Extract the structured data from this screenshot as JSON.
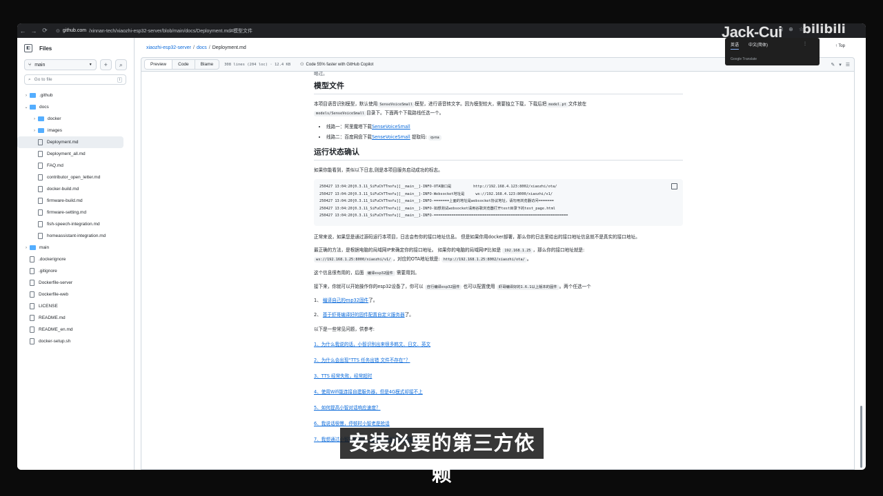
{
  "browser": {
    "url_host": "github.com",
    "url_path": "/xinnan-tech/xiaozhi-esp32-server/blob/main/docs/Deployment.md#模型文件"
  },
  "sidebar": {
    "title": "Files",
    "branch": "main",
    "goto_placeholder": "Go to file",
    "goto_kbd": "t",
    "items": [
      {
        "label": ".github",
        "type": "folder",
        "expanded": false,
        "depth": 0
      },
      {
        "label": "docs",
        "type": "folder",
        "expanded": true,
        "depth": 0
      },
      {
        "label": "docker",
        "type": "folder",
        "expanded": false,
        "depth": 1
      },
      {
        "label": "images",
        "type": "folder",
        "expanded": false,
        "depth": 1
      },
      {
        "label": "Deployment.md",
        "type": "file",
        "depth": 1,
        "selected": true
      },
      {
        "label": "Deployment_all.md",
        "type": "file",
        "depth": 1
      },
      {
        "label": "FAQ.md",
        "type": "file",
        "depth": 1
      },
      {
        "label": "contributor_open_letter.md",
        "type": "file",
        "depth": 1
      },
      {
        "label": "docker-build.md",
        "type": "file",
        "depth": 1
      },
      {
        "label": "firmware-build.md",
        "type": "file",
        "depth": 1
      },
      {
        "label": "firmware-setting.md",
        "type": "file",
        "depth": 1
      },
      {
        "label": "fish-speech-integration.md",
        "type": "file",
        "depth": 1
      },
      {
        "label": "homeassistant-integration.md",
        "type": "file",
        "depth": 1
      },
      {
        "label": "main",
        "type": "folder",
        "expanded": false,
        "depth": 0
      },
      {
        "label": ".dockerignore",
        "type": "file",
        "depth": 0
      },
      {
        "label": ".gitignore",
        "type": "file",
        "depth": 0
      },
      {
        "label": "Dockerfile-server",
        "type": "file",
        "depth": 0
      },
      {
        "label": "Dockerfile-web",
        "type": "file",
        "depth": 0
      },
      {
        "label": "LICENSE",
        "type": "file",
        "depth": 0
      },
      {
        "label": "README.md",
        "type": "file",
        "depth": 0
      },
      {
        "label": "README_en.md",
        "type": "file",
        "depth": 0
      },
      {
        "label": "docker-setup.sh",
        "type": "file",
        "depth": 0
      }
    ]
  },
  "breadcrumb": {
    "repo": "xiaozhi-esp32-server",
    "dir": "docs",
    "file": "Deployment.md",
    "top": "Top"
  },
  "filebar": {
    "tabs": [
      "Preview",
      "Code",
      "Blame"
    ],
    "lines": "308 lines (204 loc) · 12.4 KB",
    "copilot": "Code 55% faster with GitHub Copilot"
  },
  "doc": {
    "prev_tail": "略过。",
    "h_model": "模型文件",
    "p_model_a": "本项目语音识别模型，默认使用",
    "code_sensevoice": "SenseVoiceSmall",
    "p_model_b": "模型，进行语音转文字。因为模型较大，需要独立下载，下载后把",
    "code_modelpt": "model.pt",
    "p_model_c": "文件放在",
    "code_dir": "models/SenseVoiceSmall",
    "p_model_d": "目录下。下面两个下载路线任选一个。",
    "li1_a": "线路一：阿里魔塔下载",
    "li1_link": "SenseVoiceSmall",
    "li2_a": "线路二：百度网盘下载",
    "li2_link": "SenseVoiceSmall",
    "li2_b": "提取码:",
    "code_qvna": "qvna",
    "h_status": "运行状态确认",
    "p_status": "如果你能看到，类似以下日志,则是本项目服务启动成功的标志。",
    "log": [
      "250427 13:04:20[0.3.11_SiFuChTTnofu][__main__]-INFO-OTA接口是          http://192.168.4.123:8002/xiaozhi/ota/",
      "250427 13:04:20[0.3.11_SiFuChTTnofu][__main__]-INFO-Websocket地址是     ws://192.168.4.123:8000/xiaozhi/v1/",
      "250427 13:04:20[0.3.11_SiFuChTTnofu][__main__]-INFO-=======上面的地址是websocket协议地址，请勿用浏览器访问=======",
      "250427 13:04:20[0.3.11_SiFuChTTnofu][__main__]-INFO-如想测试websocket请用谷歌浏览器打开test目录下的test_page.html",
      "250427 13:04:20[0.3.11_SiFuChTTnofu][__main__]-INFO-============================================================="
    ],
    "p_normal": "正常来说，如果您是通过源码运行本项目，日志会有你的接口地址信息。 但是如果你用docker部署，那么你的日志里给出的接口地址信息就不是真实的接口地址。",
    "p_correct_a": "最正确的方法，是根据电脑的局域网IP来确定你的接口地址。 如果你的电脑的局域网IP比如是",
    "code_ip": "192.168.1.25",
    "p_correct_b": "，那么你的接口地址就是:",
    "code_ws": "ws://192.168.1.25:8000/xiaozhi/v1/",
    "p_correct_c": "，对应的OTA地址就是:",
    "code_ota": "http://192.168.1.25:8002/xiaozhi/ota/",
    "p_correct_d": "。",
    "p_useful_a": "这个信息很有用的，后面",
    "code_build": "编译esp32固件",
    "p_useful_b": "需要用到。",
    "p_next_a": "接下来，你就可以开始操作你的esp32设备了，你可以",
    "code_selfbuild": "自行编译esp32固件",
    "p_next_b": "也可以配置使用",
    "code_prebuilt": "虾哥编译好的1.6.1以上版本的固件",
    "p_next_c": "。两个任选一个",
    "opt1_num": "1、",
    "opt1": "编译自己的esp32固件",
    "opt1_end": "了。",
    "opt2_num": "2、",
    "opt2": "基于虾哥编译好的固件配置自定义服务器",
    "opt2_end": "了。",
    "p_faq": "以下是一些常见问题，供参考:",
    "faq": [
      "1、为什么我说的话，小智识别出来很多韩文、日文、英文",
      "2、为什么会出现“TTS 任务出错 文件不存在”？",
      "3、TTS 经常失败，经常超时",
      "4、使用Wifi能连接自建服务器，但是4G模式却接不上",
      "5、如何提高小智对话响应速度？",
      "6、我说话很慢，停顿时小智老是抢话",
      "7、我想通过小智控制电灯、空调、远程开关机等操作"
    ]
  },
  "translate_popup": {
    "tab1": "英语",
    "tab2": "中文(简体)",
    "footer": "Google Translate"
  },
  "overlay": {
    "watermark": "Jack-Cui",
    "logo": "bilibili",
    "subtitle": "安装必要的第三方依赖"
  }
}
